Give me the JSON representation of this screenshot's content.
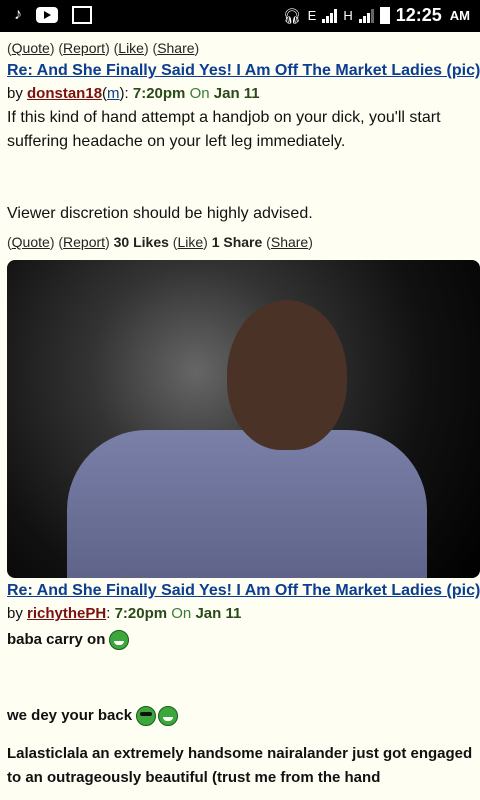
{
  "status": {
    "time": "12:25",
    "ampm": "AM",
    "net1": "E",
    "net2": "H"
  },
  "post1": {
    "actions": {
      "quote": "Quote",
      "report": "Report",
      "like": "Like",
      "share": "Share"
    },
    "title": "Re: And She Finally Said Yes! I Am Off The Market Ladies (pic)",
    "by": "by",
    "user": "donstan18",
    "mod": "m",
    "time": "7:20pm",
    "on": "On",
    "date": "Jan 11",
    "text1": "If this kind of hand attempt a handjob on your dick, you'll start suffering headache on your left leg immediately.",
    "text2": "Viewer discretion should be highly advised.",
    "actions2": {
      "quote": "Quote",
      "report": "Report",
      "likes": "30 Likes",
      "like": "Like",
      "shares": "1 Share",
      "share": "Share"
    }
  },
  "post2": {
    "title": "Re: And She Finally Said Yes! I Am Off The Market Ladies (pic)",
    "by": "by",
    "user": "richythePH",
    "time": "7:20pm",
    "on": "On",
    "date": "Jan 11",
    "text1": "baba carry on",
    "text2": "we dey your back",
    "text3": "Lalasticlala an extremely handsome nairalander just got engaged to an outrageously beautiful (trust me from the hand"
  }
}
